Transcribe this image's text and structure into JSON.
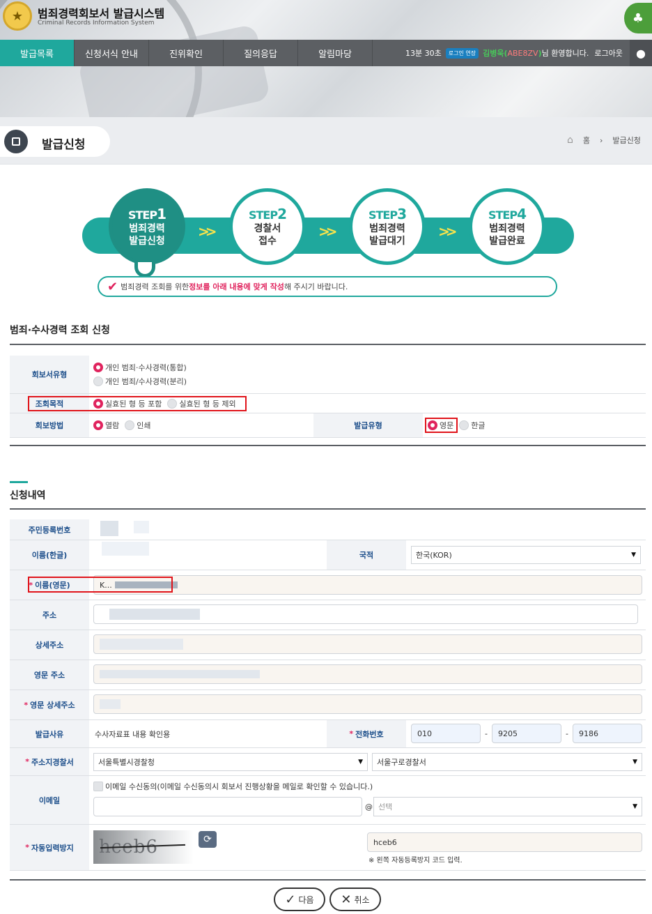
{
  "header": {
    "title": "범죄경력회보서 발급시스템",
    "subtitle": "Criminal Records Information System",
    "logo_icon": "police-emblem-icon",
    "right_logo_icon": "welfare-logo-icon"
  },
  "nav": {
    "items": [
      "발급목록",
      "신청서식 안내",
      "진위확인",
      "질의응답",
      "알림마당"
    ],
    "active_index": 0
  },
  "session": {
    "timer": "13분 30초",
    "extend_label": "로그인 연장",
    "user_name": "김병욱",
    "user_code": "ABE8ZV",
    "welcome": " 님 환영합니다.",
    "logout": "로그아웃"
  },
  "page": {
    "title": "발급신청",
    "breadcrumb": [
      "홈",
      "발급신청"
    ]
  },
  "steps": [
    {
      "label": "STEP",
      "num": "1",
      "line1": "범죄경력",
      "line2": "발급신청",
      "active": true
    },
    {
      "label": "STEP",
      "num": "2",
      "line1": "경찰서",
      "line2": "접수",
      "active": false
    },
    {
      "label": "STEP",
      "num": "3",
      "line1": "범죄경력",
      "line2": "발급대기",
      "active": false
    },
    {
      "label": "STEP",
      "num": "4",
      "line1": "범죄경력",
      "line2": "발급완료",
      "active": false
    }
  ],
  "notice": {
    "pre": "범죄경력 조회를 위한 ",
    "highlight": "정보를 아래 내용에 맞게 작성",
    "post": "해 주시기 바랍니다."
  },
  "section1": {
    "title": "범죄·수사경력 조회 신청",
    "report_type": {
      "label": "회보서유형",
      "options": [
        "개인 범죄·수사경력(통합)",
        "개인 범죄/수사경력(분리)"
      ],
      "selected": 0
    },
    "purpose": {
      "label": "조회목적",
      "options": [
        "실효된 형 등 포함",
        "실효된 형 등 제외"
      ],
      "selected": 0
    },
    "method": {
      "label": "회보방법",
      "options": [
        "열람",
        "인쇄"
      ],
      "selected": 0
    },
    "issue_type": {
      "label": "발급유형",
      "options": [
        "영문",
        "한글"
      ],
      "selected": 0
    }
  },
  "section2": {
    "title": "신청내역",
    "resident_no": {
      "label": "주민등록번호"
    },
    "name_kr": {
      "label": "이름(한글)"
    },
    "nationality": {
      "label": "국적",
      "value": "한국(KOR)"
    },
    "name_en": {
      "label": "이름(영문)",
      "value": "K...",
      "required": "*"
    },
    "address": {
      "label": "주소"
    },
    "address_detail": {
      "label": "상세주소"
    },
    "address_en": {
      "label": "영문 주소"
    },
    "address_en_detail": {
      "label": "영문 상세주소",
      "required": "*"
    },
    "reason": {
      "label": "발급사유",
      "value": "수사자료표 내용 확인용"
    },
    "phone": {
      "label": "전화번호",
      "required": "*",
      "parts": [
        "010",
        "9205",
        "9186"
      ],
      "sep": "-"
    },
    "police": {
      "label": "주소지경찰서",
      "required": "*",
      "agency": "서울특별시경찰청",
      "station": "서울구로경찰서"
    },
    "email": {
      "label": "이메일",
      "consent": "이메일 수신동의(이메일 수신동의시 회보서 진행상황을 메일로 확인할 수 있습니다.)",
      "at": "@",
      "domain_placeholder": "선택"
    },
    "captcha": {
      "label": "자동입력방지",
      "required": "*",
      "image_text": "hceb6",
      "value": "hceb6",
      "hint": "※ 왼쪽 자동등록방지 코드 입력."
    }
  },
  "buttons": {
    "next": "다음",
    "cancel": "취소"
  }
}
